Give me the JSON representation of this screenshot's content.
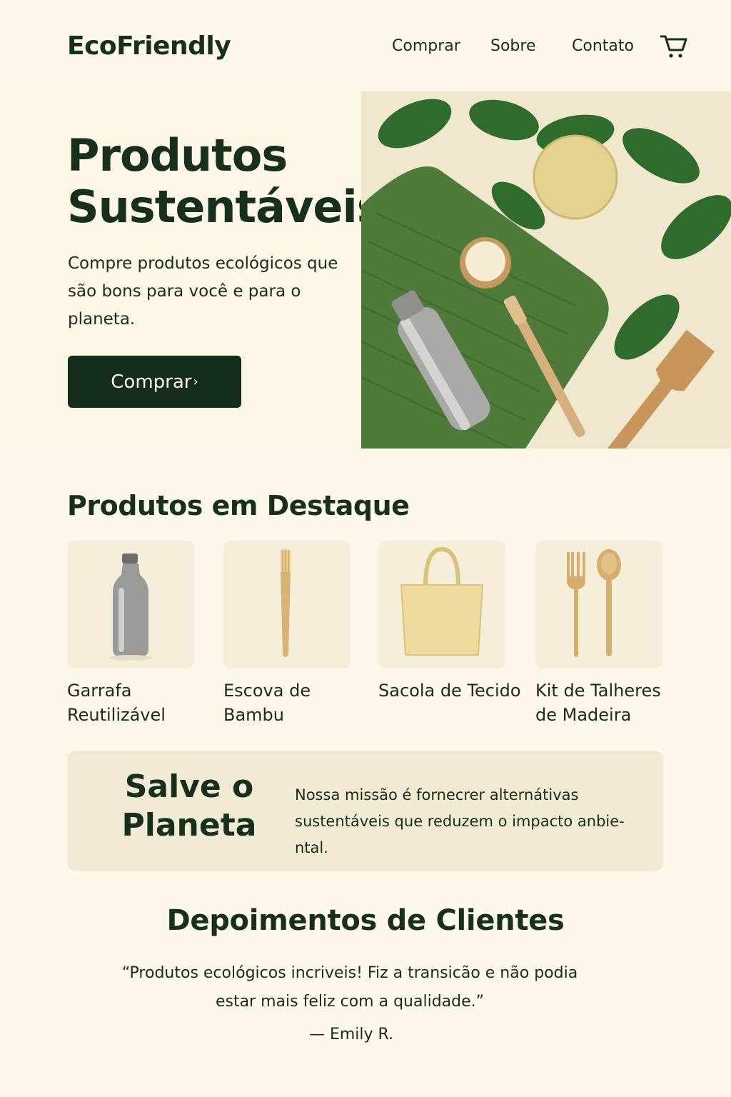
{
  "header": {
    "logo": "EcoFriendly",
    "nav": [
      "Comprar",
      "Sobre",
      "Contato"
    ],
    "cart_icon": "shopping-cart-icon"
  },
  "hero": {
    "title": "Produtos Sustentáveis",
    "subtitle": "Compre produtos ecológicos que são bons para você e para o planeta.",
    "button_label": "Comprar",
    "button_icon": "chevron-right-icon"
  },
  "featured": {
    "title": "Produtos em Destaque",
    "items": [
      {
        "name": "Garrafa Reutilizável",
        "icon": "bottle-icon"
      },
      {
        "name": "Escova de Bambu",
        "icon": "toothbrush-icon"
      },
      {
        "name": "Sacola de Tecido",
        "icon": "tote-bag-icon"
      },
      {
        "name": "Kit de Talheres de Madeira",
        "icon": "cutlery-icon"
      }
    ]
  },
  "mission": {
    "title": "Salve o Planeta",
    "text": "Nossa missão é fornecrer alternátivas sustentáveis que reduzem o impacto anbie-ntal."
  },
  "testimonials": {
    "title": "Depoimentos de Clientes",
    "quote": "“Produtos ecológicos incriveis! Fiz a transicão e não podia estar mais feliz com a qualidade.”",
    "author": "— Emily R."
  },
  "colors": {
    "background": "#fdf8ea",
    "primary": "#142d1c",
    "card": "#f5eedb",
    "mission_bg": "#f2ebd3"
  }
}
